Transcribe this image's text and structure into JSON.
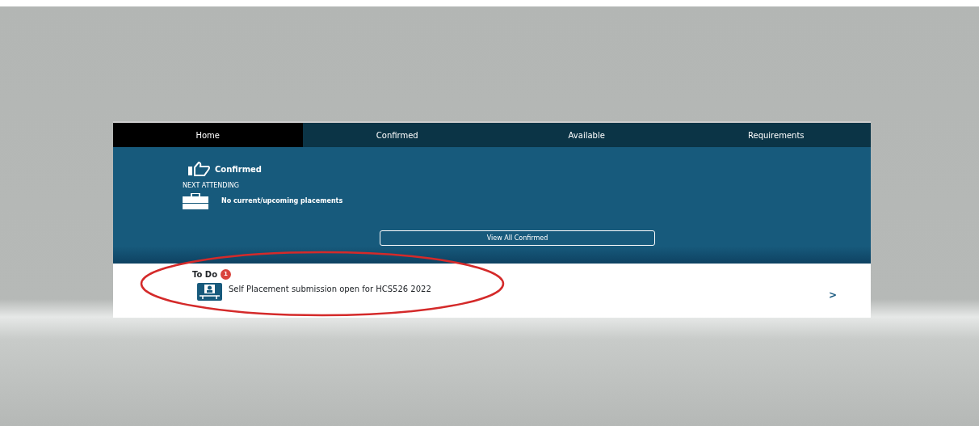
{
  "tabs": [
    {
      "label": "Home",
      "selected": true
    },
    {
      "label": "Confirmed",
      "selected": false
    },
    {
      "label": "Available",
      "selected": false
    },
    {
      "label": "Requirements",
      "selected": false
    }
  ],
  "confirmed": {
    "title": "Confirmed",
    "next_label": "NEXT ATTENDING",
    "placement": "No current/upcoming placements",
    "button": "View All Confirmed"
  },
  "todo": {
    "title": "To Do",
    "count": "1",
    "items": [
      {
        "text": "Self Placement submission open for HCS526 2022",
        "chevron": ">"
      }
    ]
  },
  "annotation": {
    "kind": "ellipse",
    "color": "#d42a2a"
  }
}
